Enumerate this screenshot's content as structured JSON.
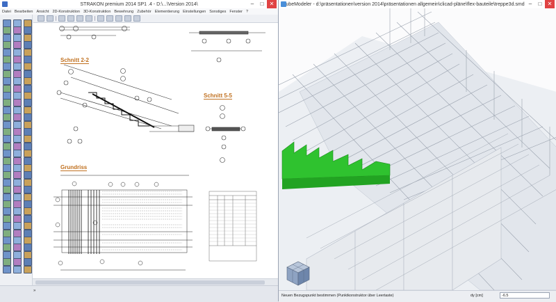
{
  "left_window": {
    "title": "STRAKON premium 2014 SP1 .4  -  D:\\...\\Version 2014\\",
    "menu": [
      "Datei",
      "Bearbeiten",
      "Ansicht",
      "2D-Konstruktion",
      "3D-Konstruktion",
      "Bewehrung",
      "Zubehör",
      "Elementierung",
      "Einstellungen",
      "Sonstiges",
      "Fenster",
      "?"
    ],
    "sections": {
      "schnitt22": "Schnitt 2-2",
      "schnitt55": "Schnitt 5-5",
      "grundriss": "Grundriss"
    },
    "status_chevron": "»"
  },
  "right_window": {
    "title": "CubeModeler - d:\\präsentationen\\version 2014\\präsentationen allgemein\\clicad-pläne\\flex-bauteile\\treppe3d.smd",
    "status_message": "Neuen Bezugspunkt bestimmen (Punktkonstruktor über Leertaste)",
    "dy_label": "dy [cm]",
    "dy_value": "-6.5"
  },
  "colors": {
    "accent_orange": "#c0701f",
    "green_model": "#2fc22f"
  }
}
